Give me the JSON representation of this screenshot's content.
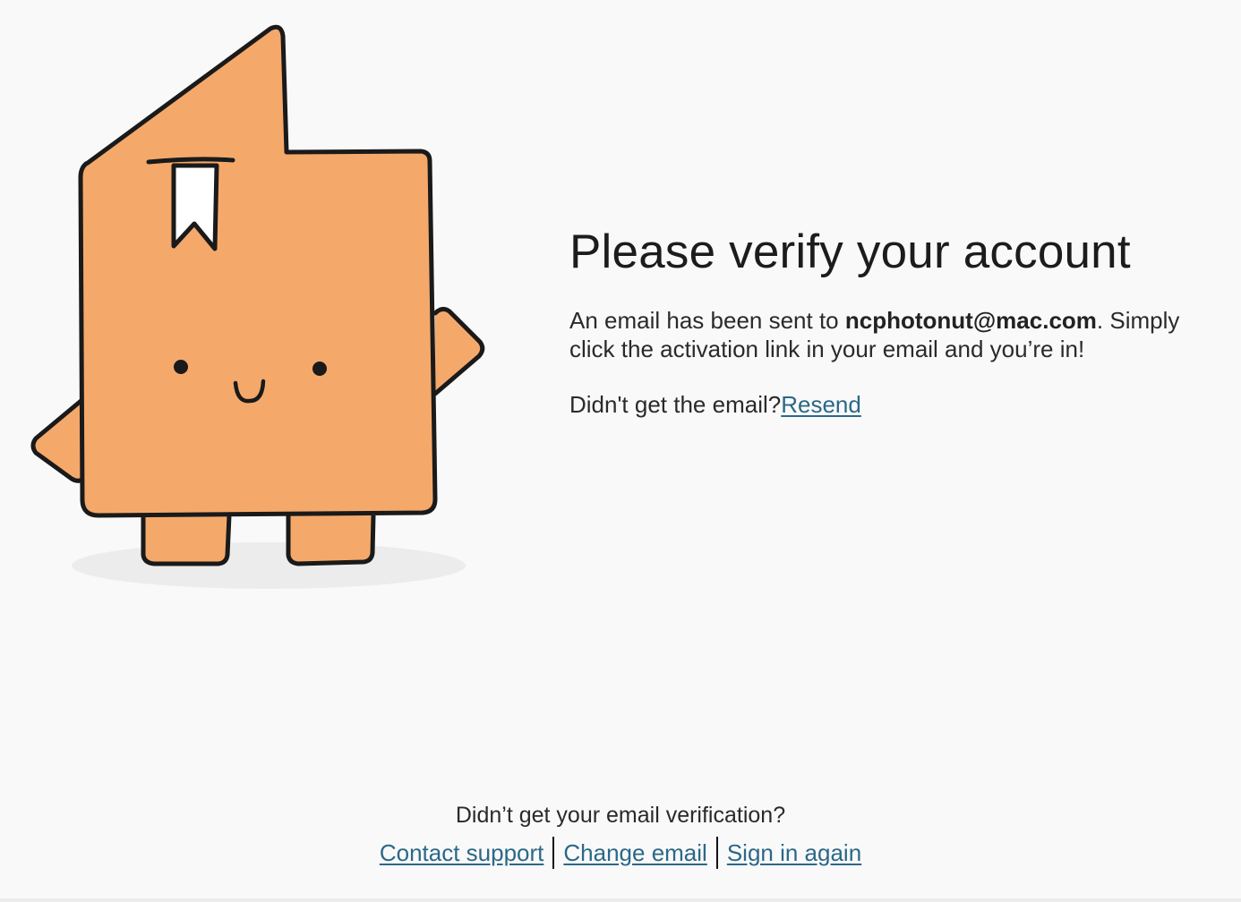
{
  "colors": {
    "background": "#f9f9f9",
    "mascot_body": "#f4a96b",
    "link": "#2b6888"
  },
  "mascot": {
    "icon": "orange-bookmark-mascot"
  },
  "verify": {
    "title": "Please verify your account",
    "message_prefix": "An email has been sent to ",
    "email": "ncphotonut@mac.com",
    "message_suffix": ". Simply click the activation link in your email and you’re in!",
    "resend_prompt": "Didn't get the email?",
    "resend_label": "Resend"
  },
  "footer": {
    "question": "Didn’t get your email verification?",
    "contact_support": "Contact support",
    "change_email": "Change email",
    "sign_in_again": "Sign in again"
  }
}
